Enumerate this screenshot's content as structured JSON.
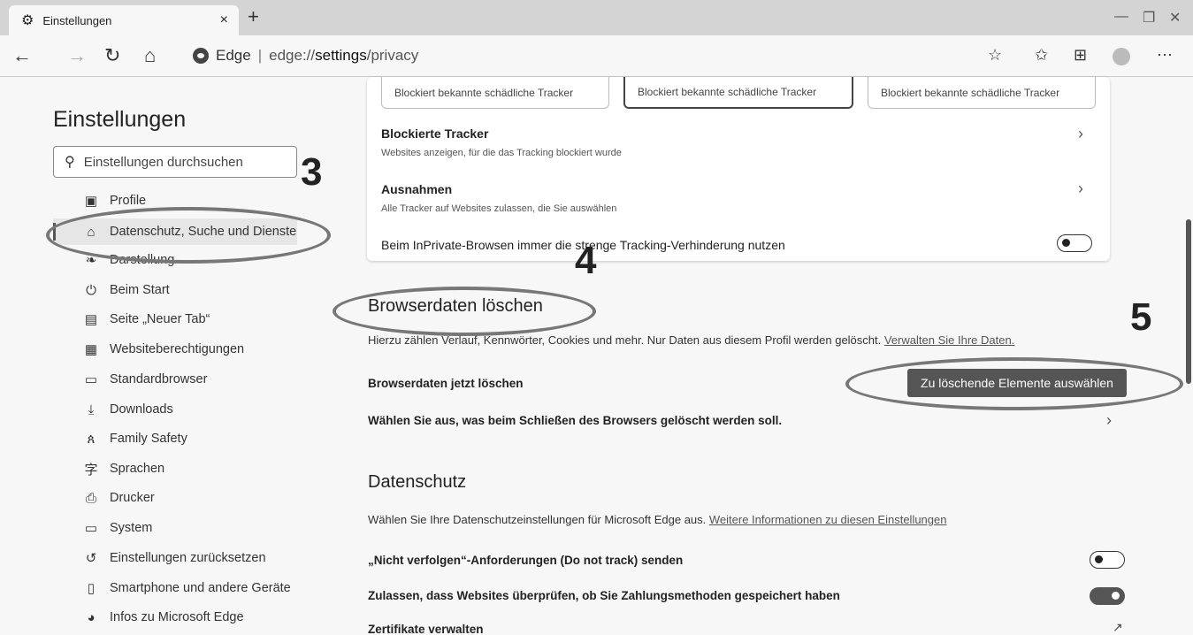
{
  "tab": {
    "title": "Einstellungen"
  },
  "address": {
    "brand": "Edge",
    "url_prefix": "edge://",
    "url_bold": "settings",
    "url_suffix": "/privacy"
  },
  "sidebar": {
    "title": "Einstellungen",
    "search_placeholder": "Einstellungen durchsuchen",
    "items": [
      {
        "label": "Profile",
        "icon": "profile-icon"
      },
      {
        "label": "Datenschutz, Suche und Dienste",
        "icon": "lock-icon"
      },
      {
        "label": "Darstellung",
        "icon": "appearance-icon"
      },
      {
        "label": "Beim Start",
        "icon": "power-icon"
      },
      {
        "label": "Seite „Neuer Tab“",
        "icon": "newtab-icon"
      },
      {
        "label": "Websiteberechtigungen",
        "icon": "site-permissions-icon"
      },
      {
        "label": "Standardbrowser",
        "icon": "default-browser-icon"
      },
      {
        "label": "Downloads",
        "icon": "download-icon"
      },
      {
        "label": "Family Safety",
        "icon": "family-icon"
      },
      {
        "label": "Sprachen",
        "icon": "language-icon"
      },
      {
        "label": "Drucker",
        "icon": "printer-icon"
      },
      {
        "label": "System",
        "icon": "system-icon"
      },
      {
        "label": "Einstellungen zurücksetzen",
        "icon": "reset-icon"
      },
      {
        "label": "Smartphone und andere Geräte",
        "icon": "phone-icon"
      },
      {
        "label": "Infos zu Microsoft Edge",
        "icon": "edge-icon"
      }
    ]
  },
  "tracking": {
    "box_text": "Blockiert bekannte schädliche Tracker",
    "blocked_title": "Blockierte Tracker",
    "blocked_sub": "Websites anzeigen, für die das Tracking blockiert wurde",
    "exceptions_title": "Ausnahmen",
    "exceptions_sub": "Alle Tracker auf Websites zulassen, die Sie auswählen",
    "inprivate_label": "Beim InPrivate-Browsen immer die strenge Tracking-Verhinderung nutzen"
  },
  "clear": {
    "title": "Browserdaten löschen",
    "desc": "Hierzu zählen Verlauf, Kennwörter, Cookies und mehr. Nur Daten aus diesem Profil werden gelöscht.",
    "desc_link": "Verwalten Sie Ihre Daten.",
    "now_label": "Browserdaten jetzt löschen",
    "button": "Zu löschende Elemente auswählen",
    "on_close": "Wählen Sie aus, was beim Schließen des Browsers gelöscht werden soll."
  },
  "privacy": {
    "title": "Datenschutz",
    "desc": "Wählen Sie Ihre Datenschutzeinstellungen für Microsoft Edge aus.",
    "desc_link": "Weitere Informationen zu diesen Einstellungen",
    "dnt": "„Nicht verfolgen“-Anforderungen (Do not track) senden",
    "payment": "Zulassen, dass Websites überprüfen, ob Sie Zahlungsmethoden gespeichert haben",
    "certs": "Zertifikate verwalten"
  },
  "annotations": {
    "n3": "3",
    "n4": "4",
    "n5": "5"
  }
}
